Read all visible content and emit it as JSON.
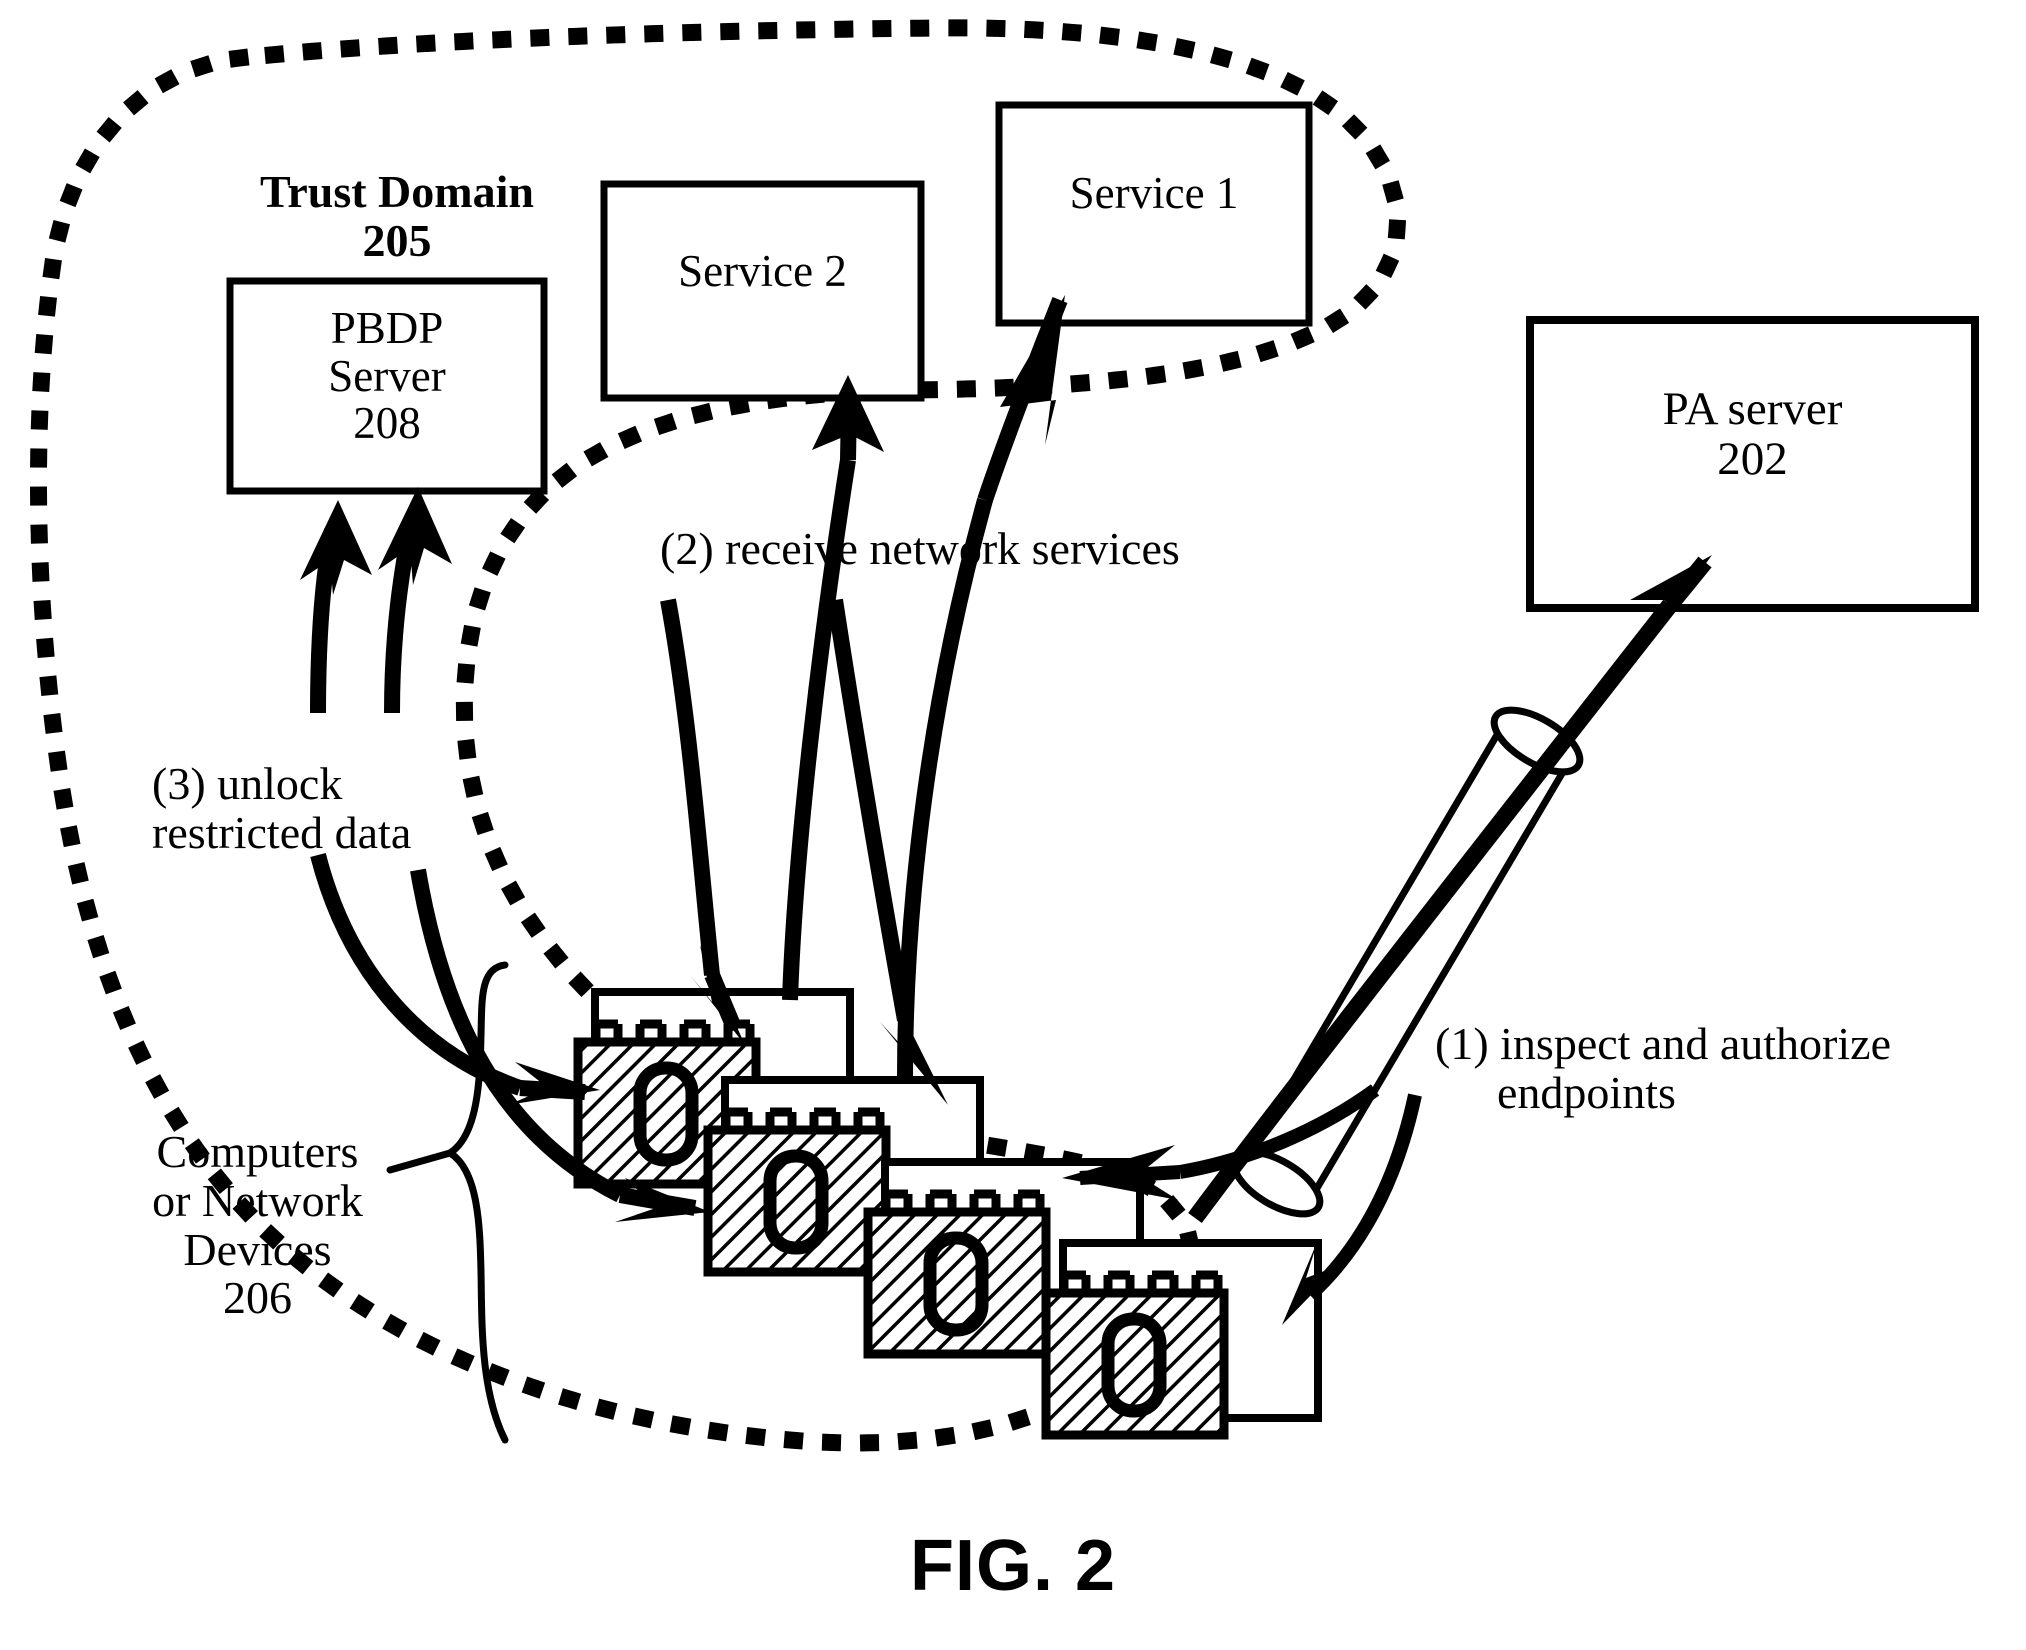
{
  "figure": {
    "caption": "FIG. 2",
    "domain_label_line1": "Trust Domain",
    "domain_label_line2": "205"
  },
  "nodes": {
    "pbdp_server": {
      "line1": "PBDP",
      "line2": "Server",
      "line3": "208"
    },
    "service2": {
      "label": "Service 2"
    },
    "service1": {
      "label": "Service 1"
    },
    "pa_server": {
      "line1": "PA server",
      "line2": "202"
    },
    "endpoints": {
      "line1": "Computers",
      "line2": "or Network",
      "line3": "Devices",
      "line4": "206",
      "device_glyph": "0",
      "device_count": 4
    }
  },
  "flows": {
    "step1": {
      "line1": "(1) inspect and authorize",
      "line2": "endpoints"
    },
    "step2": {
      "line1": "(2) receive network services"
    },
    "step3": {
      "line1": "(3) unlock",
      "line2": "restricted data"
    }
  },
  "colors": {
    "stroke": "#000000",
    "fill": "#ffffff",
    "background": "#ffffff"
  },
  "chart_data": {
    "type": "diagram",
    "title": "FIG. 2",
    "nodes": [
      {
        "id": "205",
        "label": "Trust Domain 205",
        "shape": "dotted-boundary"
      },
      {
        "id": "208",
        "label": "PBDP Server 208",
        "shape": "rectangle"
      },
      {
        "id": "service2",
        "label": "Service 2",
        "shape": "rectangle"
      },
      {
        "id": "service1",
        "label": "Service 1",
        "shape": "rectangle"
      },
      {
        "id": "202",
        "label": "PA server 202",
        "shape": "rectangle"
      },
      {
        "id": "206",
        "label": "Computers or Network Devices 206",
        "shape": "device-stack"
      }
    ],
    "edges": [
      {
        "from": "206",
        "to": "202",
        "label": "(1) inspect and authorize endpoints"
      },
      {
        "from": "206",
        "to": "service1",
        "label": "(2) receive network services"
      },
      {
        "from": "206",
        "to": "service2",
        "label": "(2) receive network services"
      },
      {
        "from": "208",
        "to": "206",
        "label": "(3) unlock restricted data"
      }
    ]
  }
}
